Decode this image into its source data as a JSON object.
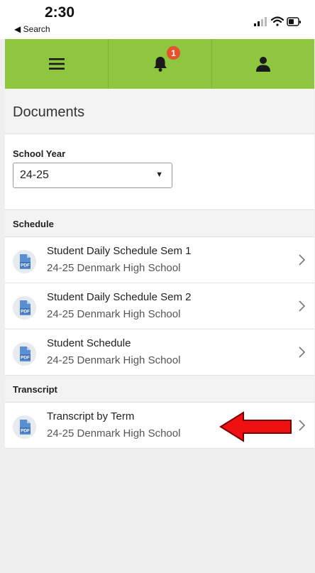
{
  "status": {
    "time": "2:30",
    "back_label": "◀ Search"
  },
  "navbar": {
    "notification_count": "1",
    "color": "#8ec63f"
  },
  "page": {
    "title": "Documents"
  },
  "school_year": {
    "label": "School Year",
    "selected": "24-25"
  },
  "sections": [
    {
      "label": "Schedule",
      "items": [
        {
          "title": "Student Daily Schedule Sem 1",
          "subtitle": "24-25 Denmark High School",
          "icon": "pdf-icon"
        },
        {
          "title": "Student Daily Schedule Sem 2",
          "subtitle": "24-25 Denmark High School",
          "icon": "pdf-icon"
        },
        {
          "title": "Student Schedule",
          "subtitle": "24-25 Denmark High School",
          "icon": "pdf-icon"
        }
      ]
    },
    {
      "label": "Transcript",
      "items": [
        {
          "title": "Transcript by Term",
          "subtitle": "24-25 Denmark High School",
          "icon": "pdf-icon"
        }
      ]
    }
  ],
  "icons": {
    "menu": "hamburger-menu-icon",
    "bell": "bell-icon",
    "user": "user-icon",
    "chevron": "chevron-right-icon",
    "annotation": "red-arrow-icon"
  },
  "pdf_icon_text": "PDF"
}
